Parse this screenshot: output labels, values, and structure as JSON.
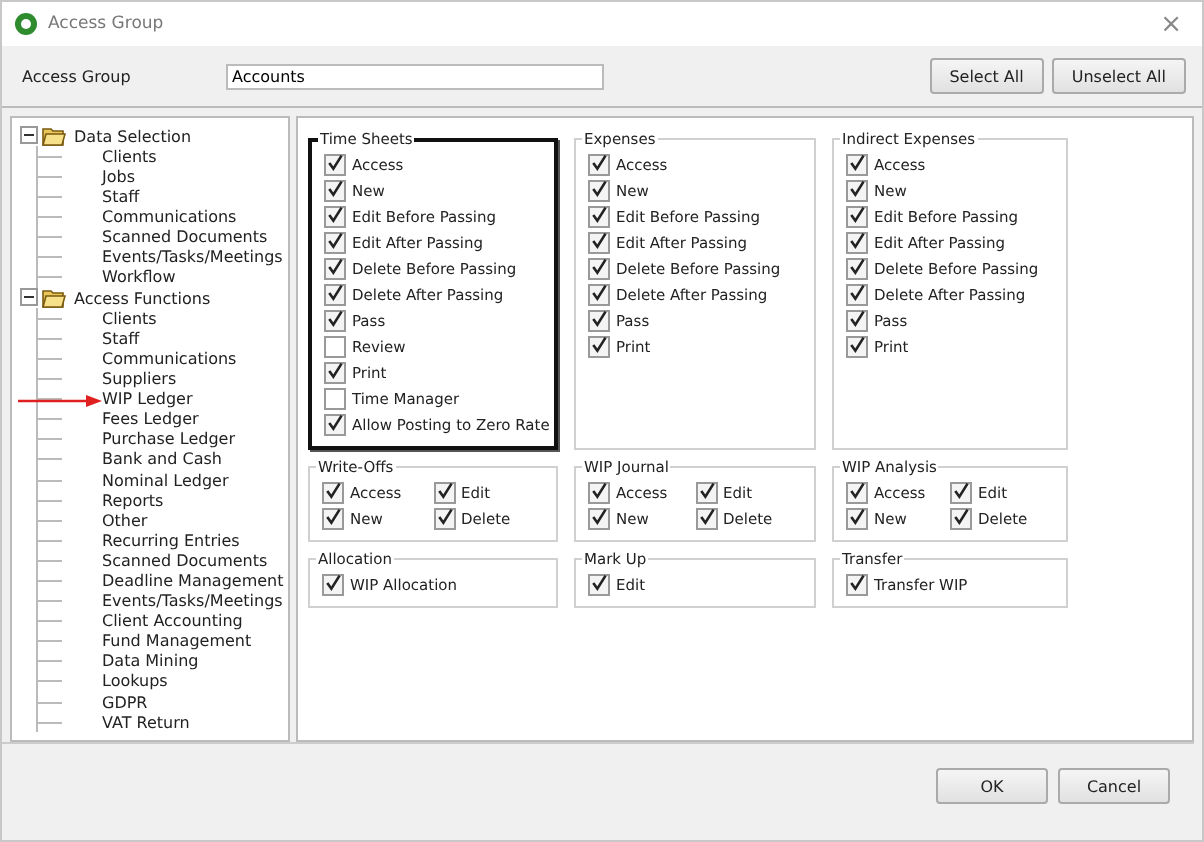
{
  "window": {
    "title": "Access Group",
    "close": "×"
  },
  "header": {
    "label": "Access Group",
    "value": "Accounts",
    "buttons": [
      "Select All",
      "Unselect All"
    ]
  },
  "tree": [
    {
      "label": "Data Selection",
      "expanded": true,
      "children": [
        {
          "label": "Clients",
          "marked": false
        },
        {
          "label": "Jobs",
          "marked": false
        },
        {
          "label": "Staff",
          "marked": false
        },
        {
          "label": "Communications",
          "marked": false
        },
        {
          "label": "Scanned Documents",
          "marked": false
        },
        {
          "label": "Events/Tasks/Meetings",
          "marked": false
        },
        {
          "label": "Workflow",
          "marked": false
        }
      ]
    },
    {
      "label": "Access Functions",
      "expanded": true,
      "children": [
        {
          "label": "Clients",
          "marked": false
        },
        {
          "label": "Staff",
          "marked": false
        },
        {
          "label": "Communications",
          "marked": false
        },
        {
          "label": "Suppliers",
          "marked": false
        },
        {
          "label": "WIP Ledger",
          "marked": true
        },
        {
          "label": "Fees Ledger",
          "marked": false
        },
        {
          "label": "Purchase Ledger",
          "marked": false
        },
        {
          "label": "Bank and Cash",
          "marked": false
        },
        {
          "label": "Nominal Ledger",
          "marked": false
        },
        {
          "label": "Reports",
          "marked": false
        },
        {
          "label": "Other",
          "marked": false
        },
        {
          "label": "Recurring Entries",
          "marked": false
        },
        {
          "label": "Scanned Documents",
          "marked": false
        },
        {
          "label": "Deadline Management",
          "marked": false
        },
        {
          "label": "Events/Tasks/Meetings",
          "marked": false
        },
        {
          "label": "Client Accounting",
          "marked": false
        },
        {
          "label": "Fund Management",
          "marked": false
        },
        {
          "label": "Data Mining",
          "marked": false
        },
        {
          "label": "Lookups",
          "marked": false
        },
        {
          "label": "GDPR",
          "marked": false
        },
        {
          "label": "VAT Return",
          "marked": false
        }
      ]
    }
  ],
  "groups": [
    {
      "title": "Time Sheets",
      "highlighted": true,
      "kind": "list",
      "options": [
        {
          "label": "Access",
          "checked": true
        },
        {
          "label": "New",
          "checked": true
        },
        {
          "label": "Edit Before Passing",
          "checked": true
        },
        {
          "label": "Edit After Passing",
          "checked": true
        },
        {
          "label": "Delete Before Passing",
          "checked": true
        },
        {
          "label": "Delete After Passing",
          "checked": true
        },
        {
          "label": "Pass",
          "checked": true
        },
        {
          "label": "Review",
          "checked": false
        },
        {
          "label": "Print",
          "checked": true
        },
        {
          "label": "Time Manager",
          "checked": false
        },
        {
          "label": "Allow Posting to Zero Rate",
          "checked": true
        }
      ]
    },
    {
      "title": "Expenses",
      "highlighted": false,
      "kind": "list",
      "options": [
        {
          "label": "Access",
          "checked": true
        },
        {
          "label": "New",
          "checked": true
        },
        {
          "label": "Edit Before Passing",
          "checked": true
        },
        {
          "label": "Edit After Passing",
          "checked": true
        },
        {
          "label": "Delete Before Passing",
          "checked": true
        },
        {
          "label": "Delete After Passing",
          "checked": true
        },
        {
          "label": "Pass",
          "checked": true
        },
        {
          "label": "Print",
          "checked": true
        }
      ]
    },
    {
      "title": "Indirect Expenses",
      "highlighted": false,
      "kind": "list",
      "options": [
        {
          "label": "Access",
          "checked": true
        },
        {
          "label": "New",
          "checked": true
        },
        {
          "label": "Edit Before Passing",
          "checked": true
        },
        {
          "label": "Edit After Passing",
          "checked": true
        },
        {
          "label": "Delete Before Passing",
          "checked": true
        },
        {
          "label": "Delete After Passing",
          "checked": true
        },
        {
          "label": "Pass",
          "checked": true
        },
        {
          "label": "Print",
          "checked": true
        }
      ]
    },
    {
      "title": "Write-Offs",
      "highlighted": false,
      "kind": "grid",
      "options": [
        {
          "label": "Access",
          "checked": true
        },
        {
          "label": "Edit",
          "checked": true
        },
        {
          "label": "New",
          "checked": true
        },
        {
          "label": "Delete",
          "checked": true
        }
      ]
    },
    {
      "title": "WIP Journal",
      "highlighted": false,
      "kind": "grid",
      "options": [
        {
          "label": "Access",
          "checked": true
        },
        {
          "label": "Edit",
          "checked": true
        },
        {
          "label": "New",
          "checked": true
        },
        {
          "label": "Delete",
          "checked": true
        }
      ]
    },
    {
      "title": "WIP Analysis",
      "highlighted": false,
      "kind": "grid",
      "options": [
        {
          "label": "Access",
          "checked": true
        },
        {
          "label": "Edit",
          "checked": true
        },
        {
          "label": "New",
          "checked": true
        },
        {
          "label": "Delete",
          "checked": true
        }
      ]
    },
    {
      "title": "Allocation",
      "highlighted": false,
      "kind": "list",
      "options": [
        {
          "label": "WIP Allocation",
          "checked": true
        }
      ]
    },
    {
      "title": "Mark Up",
      "highlighted": false,
      "kind": "list",
      "options": [
        {
          "label": "Edit",
          "checked": true
        }
      ]
    },
    {
      "title": "Transfer",
      "highlighted": false,
      "kind": "list",
      "options": [
        {
          "label": "Transfer WIP",
          "checked": true
        }
      ]
    }
  ],
  "footer": {
    "buttons": [
      "OK",
      "Cancel"
    ]
  }
}
